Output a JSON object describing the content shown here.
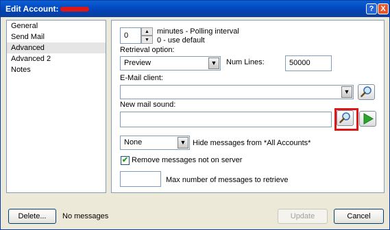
{
  "window": {
    "title": "Edit Account:",
    "help_icon": "?",
    "close_icon": "X"
  },
  "sidebar": {
    "items": [
      {
        "label": "General"
      },
      {
        "label": "Send Mail"
      },
      {
        "label": "Advanced"
      },
      {
        "label": "Advanced 2"
      },
      {
        "label": "Notes"
      }
    ],
    "selected": "Advanced"
  },
  "polling": {
    "value": "0",
    "label_line1": "minutes - Polling interval",
    "label_line2": "0 - use default"
  },
  "retrieval": {
    "label": "Retrieval option:",
    "selected": "Preview",
    "num_lines_label": "Num Lines:",
    "num_lines_value": "50000"
  },
  "email_client": {
    "label": "E-Mail client:",
    "value": ""
  },
  "new_mail_sound": {
    "label": "New mail sound:",
    "value": ""
  },
  "hide_messages": {
    "selected": "None",
    "label": "Hide messages from *All Accounts*"
  },
  "remove_messages": {
    "checked": true,
    "label": "Remove messages not on server"
  },
  "max_messages": {
    "value": "",
    "label": "Max number of messages to retrieve"
  },
  "footer": {
    "delete_label": "Delete...",
    "status_text": "No messages",
    "update_label": "Update",
    "cancel_label": "Cancel"
  },
  "icons": {
    "browse": "magnifier-icon",
    "play": "play-icon",
    "dropdown": "chevron-down-icon",
    "spin_up": "arrow-up-icon",
    "spin_down": "arrow-down-icon"
  },
  "colors": {
    "titlebar": "#0a5fd8",
    "highlight": "#e01515",
    "play": "#2ca52c"
  }
}
